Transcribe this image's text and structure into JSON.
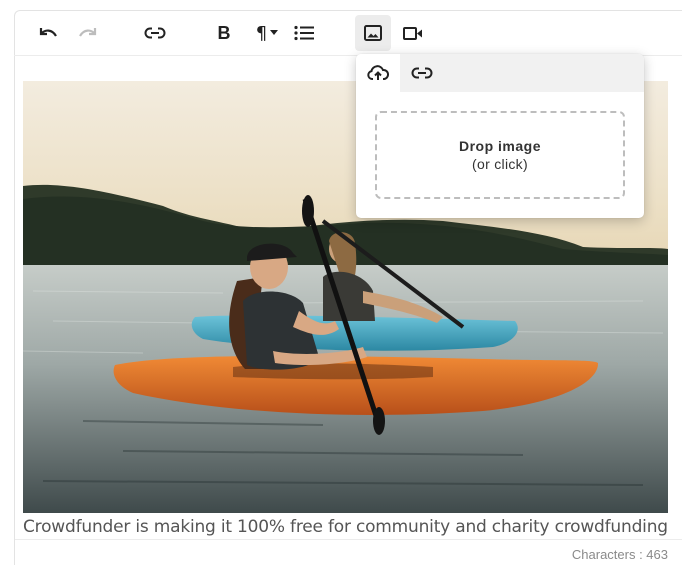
{
  "toolbar": {
    "icons": [
      "undo-icon",
      "redo-icon",
      "link-icon",
      "bold-icon",
      "paragraph-icon",
      "bullet-list-icon",
      "image-icon",
      "video-icon"
    ],
    "bold_label": "B",
    "paragraph_label": "¶"
  },
  "image_popover": {
    "tabs": [
      "upload-icon",
      "link-icon"
    ],
    "drop_title": "Drop image",
    "drop_subtitle": "(or click)"
  },
  "content": {
    "caption": "Crowdfunder is making it 100% free for community and charity crowdfunding"
  },
  "footer": {
    "characters": "Characters : 463"
  }
}
